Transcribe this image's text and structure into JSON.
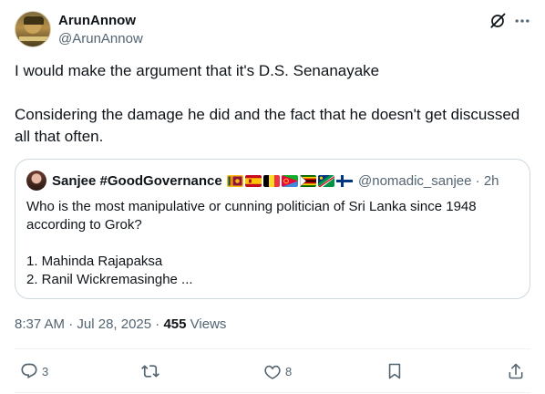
{
  "author": {
    "display_name": "ArunAnnow",
    "handle": "@ArunAnnow"
  },
  "icons": {
    "grok": "grok-icon",
    "more": "more-icon"
  },
  "tweet": {
    "paragraphs": [
      "I would make the argument that it's D.S. Senanayake",
      "Considering the damage he did and the fact that he doesn't get discussed all that often."
    ]
  },
  "quote": {
    "display_name": "Sanjee #GoodGovernance",
    "flags": [
      "sri-lanka-flag",
      "spain-flag",
      "belgium-flag",
      "eritrea-flag",
      "zimbabwe-flag",
      "namibia-flag",
      "finland-flag"
    ],
    "handle": "@nomadic_sanjee",
    "separator": "·",
    "time": "2h",
    "text_lines": [
      "Who is the most manipulative or cunning politician of Sri Lanka since 1948 according to Grok?",
      "1. Mahinda Rajapaksa",
      "2. Ranil Wickremasinghe ..."
    ]
  },
  "meta": {
    "time": "8:37 AM",
    "separator": "·",
    "date": "Jul 28, 2025",
    "separator2": "·",
    "views_count": "455",
    "views_label": "Views"
  },
  "actions": {
    "replies": "3",
    "reposts": "",
    "likes": "8"
  },
  "colors": {
    "text": "#0f1419",
    "secondary": "#536471",
    "border": "#cfd9de",
    "divider": "#eff3f4"
  }
}
